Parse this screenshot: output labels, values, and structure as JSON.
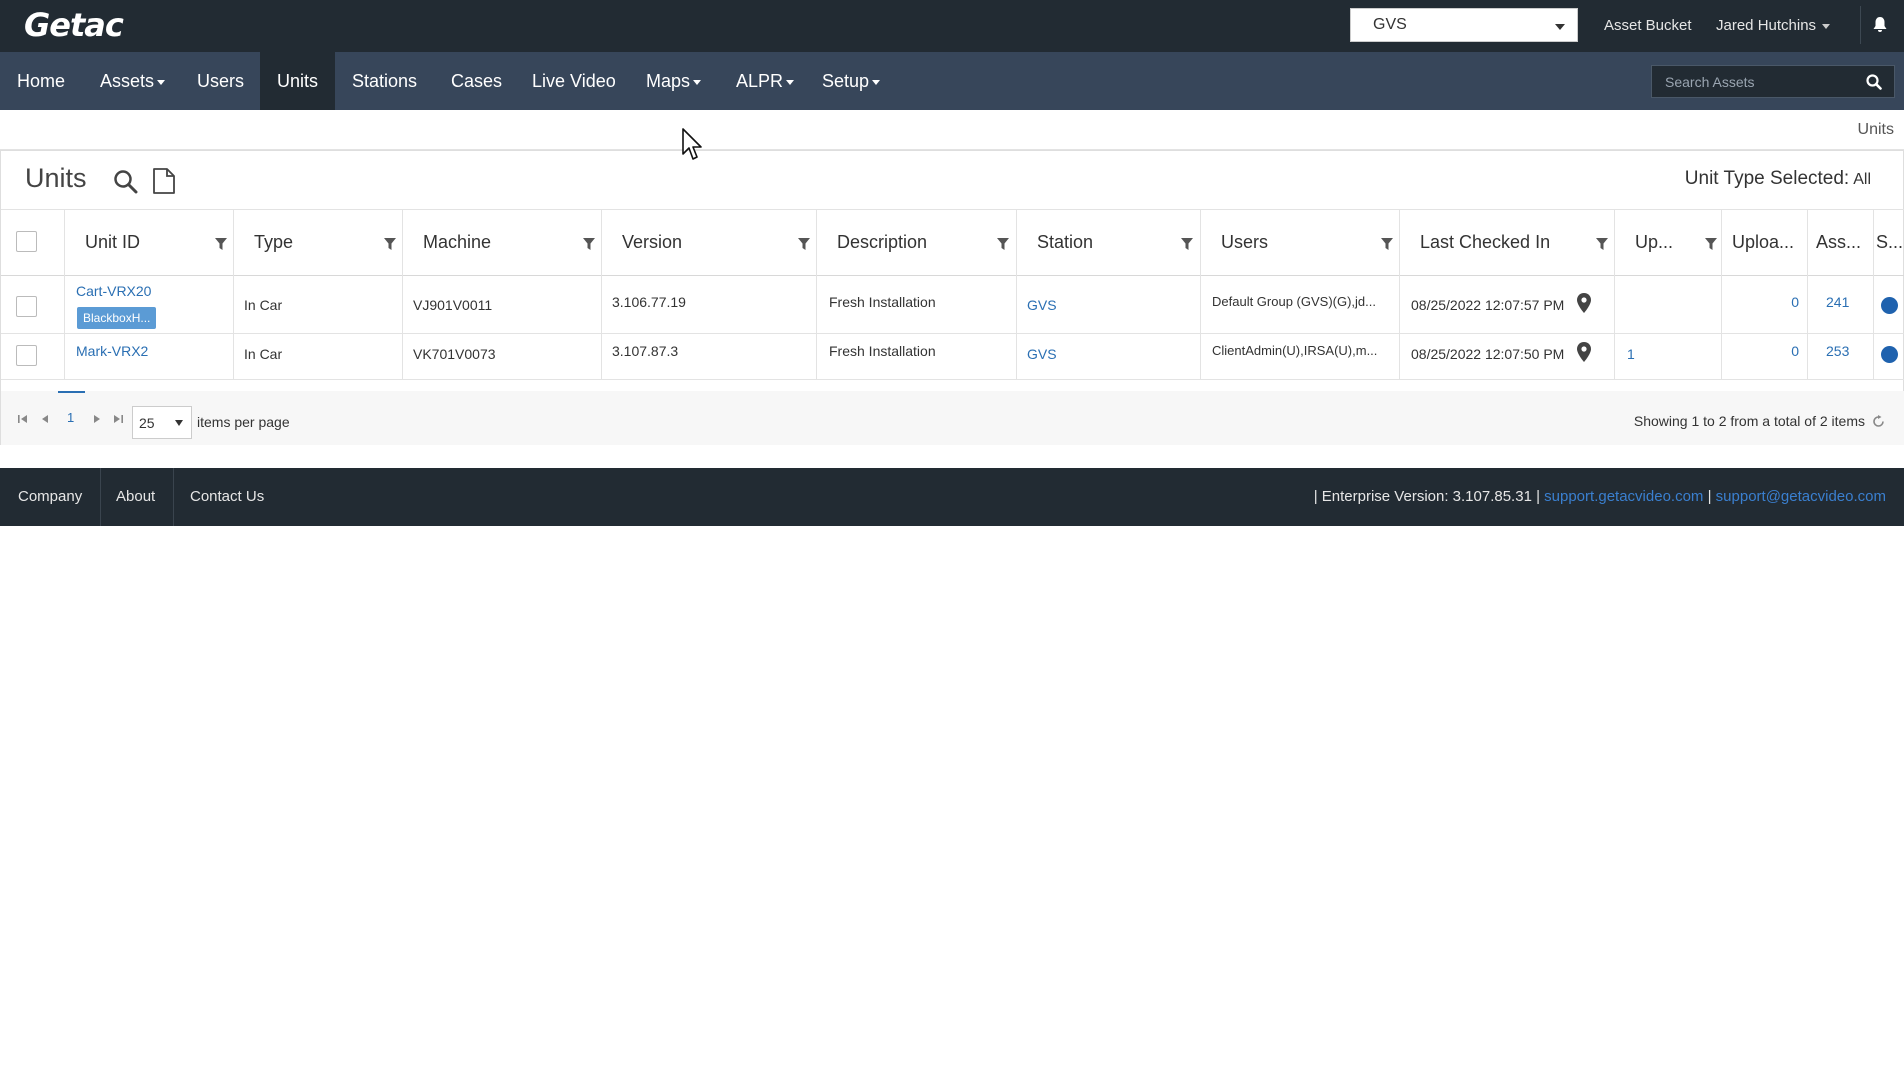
{
  "header": {
    "logo": "Getac",
    "station_select": "GVS",
    "asset_bucket": "Asset Bucket",
    "user_name": "Jared Hutchins"
  },
  "nav": {
    "items": [
      {
        "label": "Home"
      },
      {
        "label": "Assets"
      },
      {
        "label": "Users"
      },
      {
        "label": "Units"
      },
      {
        "label": "Stations"
      },
      {
        "label": "Cases"
      },
      {
        "label": "Live Video"
      },
      {
        "label": "Maps"
      },
      {
        "label": "ALPR"
      },
      {
        "label": "Setup"
      }
    ],
    "active": "Units",
    "search_placeholder": "Search Assets"
  },
  "breadcrumb": "Units",
  "page": {
    "title": "Units",
    "unit_type_label": "Unit Type Selected:",
    "unit_type_value": "All"
  },
  "table": {
    "columns": [
      "Unit ID",
      "Type",
      "Machine",
      "Version",
      "Description",
      "Station",
      "Users",
      "Last Checked In",
      "Up...",
      "Uploa...",
      "Ass...",
      "S..."
    ],
    "rows": [
      {
        "unit_id": "Cart-VRX20",
        "tag": "BlackboxH...",
        "type": "In Car",
        "machine": "VJ901V0011",
        "version": "3.106.77.19",
        "description": "Fresh Installation",
        "station": "GVS",
        "users": "Default Group (GVS)(G),jd...",
        "last_checked_in": "08/25/2022 12:07:57 PM",
        "up": "",
        "uploads": "0",
        "assets": "241",
        "status_color": "#1f62ae"
      },
      {
        "unit_id": "Mark-VRX2",
        "tag": "",
        "type": "In Car",
        "machine": "VK701V0073",
        "version": "3.107.87.3",
        "description": "Fresh Installation",
        "station": "GVS",
        "users": "ClientAdmin(U),IRSA(U),m...",
        "last_checked_in": "08/25/2022 12:07:50 PM",
        "up": "1",
        "uploads": "0",
        "assets": "253",
        "status_color": "#1f62ae"
      }
    ]
  },
  "pager": {
    "current_page": "1",
    "page_size": "25",
    "items_per_page_label": "items per page",
    "summary": "Showing 1 to 2 from a total of 2 items"
  },
  "footer": {
    "links": [
      "Company",
      "About",
      "Contact Us"
    ],
    "version_text": "| Enterprise Version: 3.107.85.31 |",
    "support_url": "support.getacvideo.com",
    "separator": "|",
    "support_email": "support@getacvideo.com"
  },
  "colors": {
    "topbar": "#222b33",
    "navbar": "#37465a",
    "link": "#2a6fb3",
    "status": "#1f62ae"
  }
}
